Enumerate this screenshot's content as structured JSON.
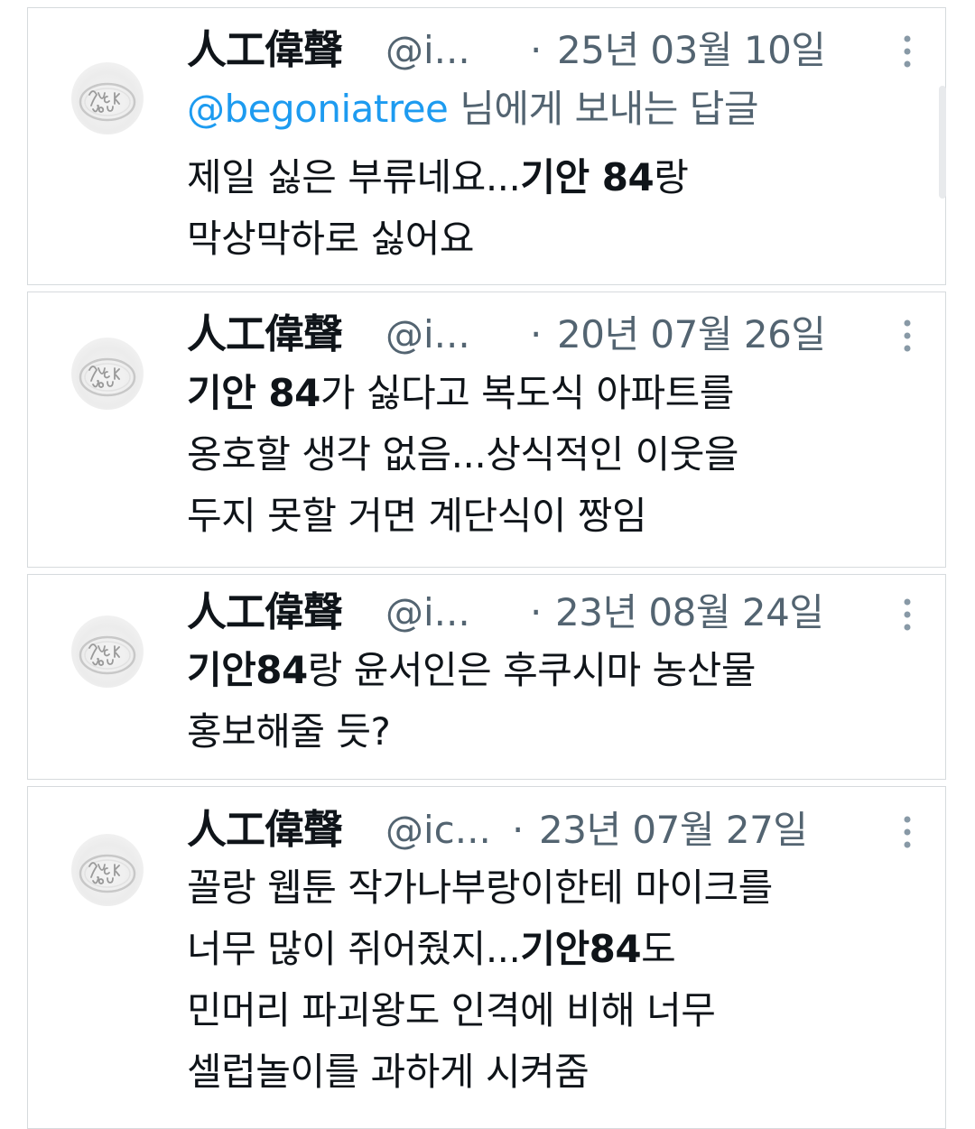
{
  "tweets": [
    {
      "name": "人工偉聲",
      "handle": "@i...",
      "separator": "·",
      "date": "25년 03월 10일",
      "reply_prefix": "@begoniatree",
      "reply_suffix": " 님에게 보내는 답글",
      "line1_a": "제일 싫은 부류네요...",
      "line1_bold": "기안 84",
      "line1_b": "랑",
      "line2": "막상막하로 싫어요"
    },
    {
      "name": "人工偉聲",
      "handle": "@i...",
      "separator": "·",
      "date": "20년 07월 26일",
      "line1_bold": "기안 84",
      "line1_b": "가 싫다고 복도식 아파트를",
      "line2": "옹호할 생각 없음...상식적인 이웃을",
      "line3": "두지 못할 거면 계단식이 짱임"
    },
    {
      "name": "人工偉聲",
      "handle": "@i...",
      "separator": "·",
      "date": "23년 08월 24일",
      "line1_bold": "기안84",
      "line1_b": "랑 윤서인은 후쿠시마 농산물",
      "line2": "홍보해줄 듯?"
    },
    {
      "name": "人工偉聲",
      "handle": "@ic...",
      "separator": "·",
      "date": "23년 07월 27일",
      "line1": "꼴랑 웹툰 작가나부랑이한테 마이크를",
      "line2_a": "너무 많이 쥐어줬지...",
      "line2_bold": "기안84",
      "line2_b": "도",
      "line3": "민머리 파괴왕도 인격에 비해 너무",
      "line4": "셀럽놀이를 과하게 시켜줌"
    }
  ],
  "icons": {
    "avatar": "ring-fuck-you-avatar",
    "more": "more-vertical-icon"
  },
  "colors": {
    "text": "#0f1419",
    "secondary": "#536471",
    "mention": "#1d9bf0",
    "border": "#d6dadd"
  }
}
